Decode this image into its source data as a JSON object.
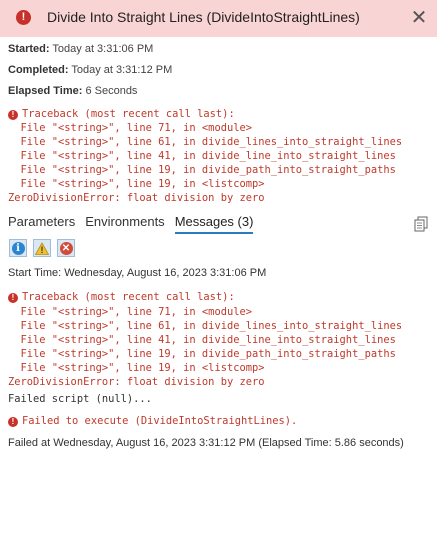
{
  "header": {
    "title": "Divide Into Straight Lines (DivideIntoStraightLines)",
    "error_icon_glyph": "!",
    "close_glyph": "✕",
    "bg_color": "#f9d4d4"
  },
  "meta": {
    "started_label": "Started:",
    "started_value": "Today at 3:31:06 PM",
    "completed_label": "Completed:",
    "completed_value": "Today at 3:31:12 PM",
    "elapsed_label": "Elapsed Time:",
    "elapsed_value": "6 Seconds"
  },
  "traceback": {
    "header": "Traceback (most recent call last):",
    "lines": [
      "  File \"<string>\", line 71, in <module>",
      "  File \"<string>\", line 61, in divide_lines_into_straight_lines",
      "  File \"<string>\", line 41, in divide_line_into_straight_lines",
      "  File \"<string>\", line 19, in divide_path_into_straight_paths",
      "  File \"<string>\", line 19, in <listcomp>"
    ],
    "error": "ZeroDivisionError: float division by zero"
  },
  "tabs": [
    {
      "label": "Parameters",
      "active": false
    },
    {
      "label": "Environments",
      "active": false
    },
    {
      "label": "Messages (3)",
      "active": true
    }
  ],
  "filters": {
    "info_glyph": "i",
    "warning_glyph": "!",
    "error_glyph": "✕"
  },
  "messages": {
    "start_time": "Start Time: Wednesday, August 16, 2023 3:31:06 PM",
    "traceback_header": "Traceback (most recent call last):",
    "traceback_lines": [
      "  File \"<string>\", line 71, in <module>",
      "  File \"<string>\", line 61, in divide_lines_into_straight_lines",
      "  File \"<string>\", line 41, in divide_line_into_straight_lines",
      "  File \"<string>\", line 19, in divide_path_into_straight_paths",
      "  File \"<string>\", line 19, in <listcomp>"
    ],
    "traceback_error": "ZeroDivisionError: float division by zero",
    "failed_script": "Failed script (null)...",
    "failed_execute": "Failed to execute (DivideIntoStraightLines).",
    "failed_at": "Failed at Wednesday, August 16, 2023 3:31:12 PM (Elapsed Time: 5.86 seconds)"
  },
  "colors": {
    "error_red": "#c0392b",
    "tab_underline": "#2a7bbf"
  }
}
